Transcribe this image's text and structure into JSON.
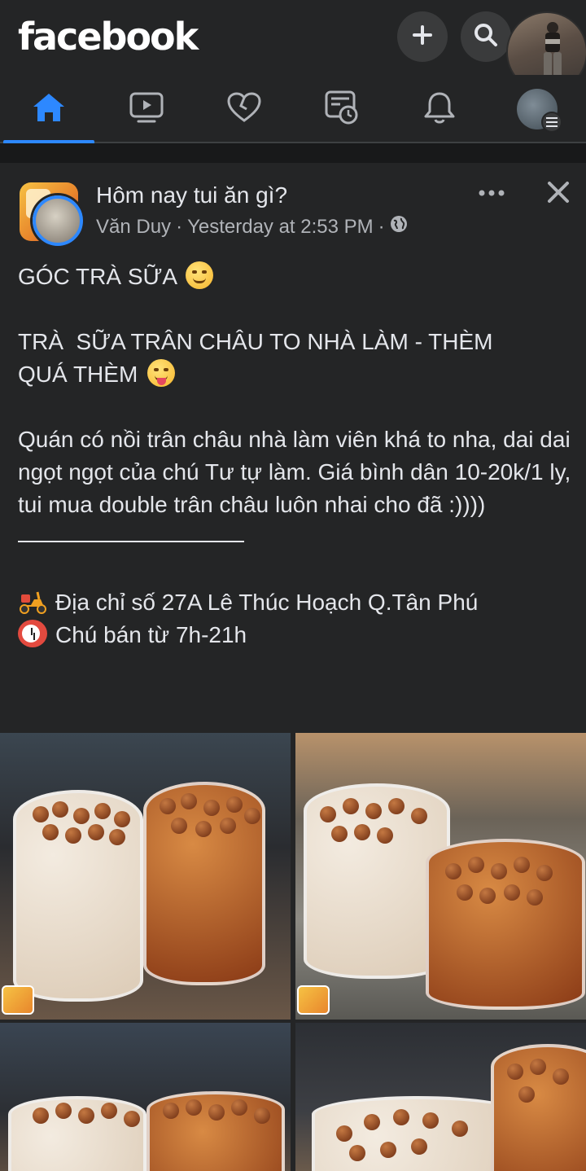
{
  "app": {
    "logo_text": "facebook",
    "accent_color": "#2d88ff"
  },
  "topbar": {
    "actions": [
      {
        "name": "create",
        "icon": "plus-icon"
      },
      {
        "name": "search",
        "icon": "search-icon"
      }
    ]
  },
  "nav": {
    "tabs": [
      {
        "name": "home",
        "icon": "home-icon",
        "active": true
      },
      {
        "name": "watch",
        "icon": "video-icon",
        "active": false
      },
      {
        "name": "dating",
        "icon": "heart-icon",
        "active": false
      },
      {
        "name": "news-feed",
        "icon": "feed-clock-icon",
        "active": false
      },
      {
        "name": "notifications",
        "icon": "bell-icon",
        "active": false
      },
      {
        "name": "menu",
        "icon": "menu-icon",
        "active": false
      }
    ]
  },
  "post": {
    "group_name": "Hôm nay tui ăn gì?",
    "author": "Văn Duy",
    "separator": "·",
    "timestamp": "Yesterday at 2:53 PM",
    "privacy_icon": "globe-icon",
    "lines": {
      "heading": "GÓC TRÀ SỮA",
      "title_1": "TRÀ  SỮA TRÂN CHÂU TO NHÀ LÀM - THÈM",
      "title_2": "QUÁ THÈM",
      "body": "Quán có nồi trân châu nhà làm viên khá to nha, dai dai ngọt ngọt của chú Tư tự làm. Giá bình dân 10-20k/1 ly, tui mua double trân châu luôn nhai cho đã :))))",
      "address": "Địa chỉ số 27A Lê Thúc Hoạch Q.Tân Phú",
      "hours": "Chú bán từ 7h-21h"
    },
    "emojis": {
      "heading": "smiling-face-icon",
      "title": "tongue-face-icon",
      "address": "scooter-icon",
      "hours": "alarm-clock-icon"
    },
    "photos": [
      {
        "name": "photo-1"
      },
      {
        "name": "photo-2"
      },
      {
        "name": "photo-3"
      },
      {
        "name": "photo-4"
      }
    ]
  }
}
